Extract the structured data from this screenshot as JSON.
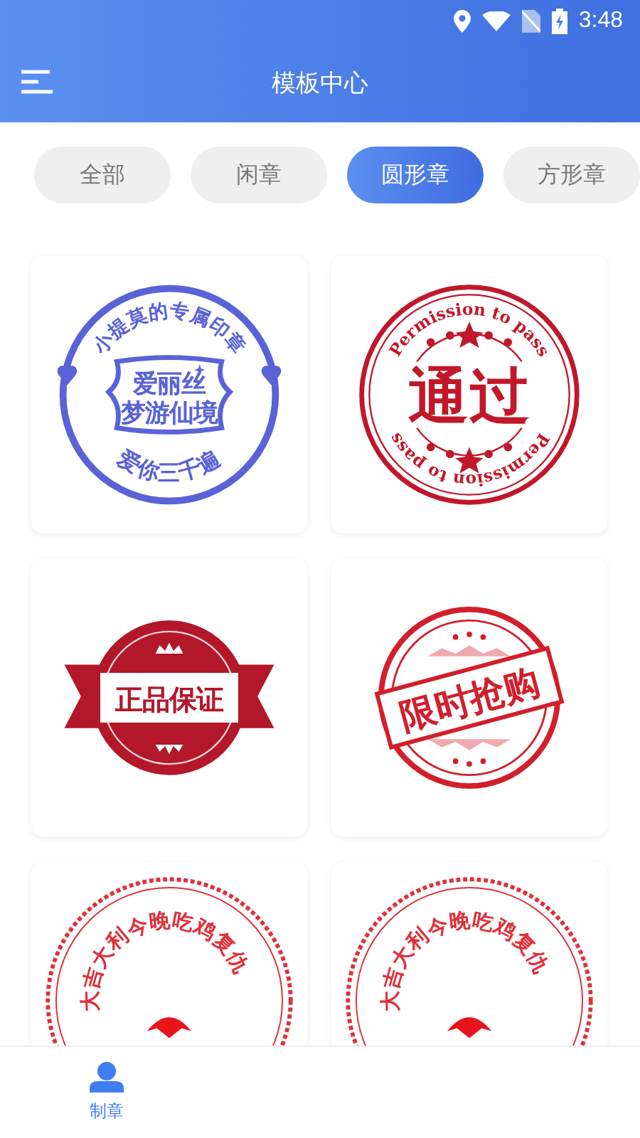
{
  "status_bar": {
    "time": "3:48"
  },
  "header": {
    "title": "模板中心"
  },
  "tabs": [
    {
      "label": "全部",
      "selected": false
    },
    {
      "label": "闲章",
      "selected": false
    },
    {
      "label": "圆形章",
      "selected": true
    },
    {
      "label": "方形章",
      "selected": false
    }
  ],
  "templates": [
    {
      "kind": "ring",
      "top": "小提莫的专属印章",
      "lines": [
        "爱丽丝",
        "梦游仙境"
      ],
      "bottom": "爱你三千遍"
    },
    {
      "kind": "pass",
      "top": "Permission to pass",
      "lines": [
        "通过"
      ],
      "bottom": "Permission to pass"
    },
    {
      "kind": "ribbon",
      "lines": [
        "正品保证"
      ]
    },
    {
      "kind": "slanted",
      "lines": [
        "限时抢购"
      ]
    },
    {
      "kind": "ornate",
      "top": "大吉大利今晚吃鸡复仇"
    },
    {
      "kind": "ornate",
      "top": "大吉大利今晚吃鸡复仇"
    }
  ],
  "bottom_nav": [
    {
      "label": "制章",
      "selected": true
    }
  ]
}
